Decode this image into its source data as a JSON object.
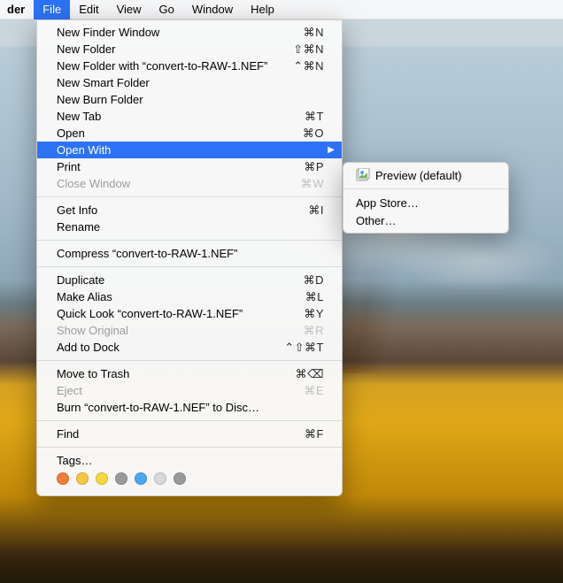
{
  "menubar": {
    "app": "der",
    "items": [
      "File",
      "Edit",
      "View",
      "Go",
      "Window",
      "Help"
    ],
    "activeIndex": 0
  },
  "fileMenu": {
    "groups": [
      [
        {
          "label": "New Finder Window",
          "shortcut": "⌘N"
        },
        {
          "label": "New Folder",
          "shortcut": "⇧⌘N"
        },
        {
          "label": "New Folder with “convert-to-RAW-1.NEF”",
          "shortcut": "⌃⌘N"
        },
        {
          "label": "New Smart Folder",
          "shortcut": ""
        },
        {
          "label": "New Burn Folder",
          "shortcut": ""
        },
        {
          "label": "New Tab",
          "shortcut": "⌘T"
        },
        {
          "label": "Open",
          "shortcut": "⌘O"
        },
        {
          "label": "Open With",
          "shortcut": "",
          "submenu": true,
          "highlight": true
        },
        {
          "label": "Print",
          "shortcut": "⌘P"
        },
        {
          "label": "Close Window",
          "shortcut": "⌘W",
          "disabled": true
        }
      ],
      [
        {
          "label": "Get Info",
          "shortcut": "⌘I"
        },
        {
          "label": "Rename",
          "shortcut": ""
        }
      ],
      [
        {
          "label": "Compress “convert-to-RAW-1.NEF”",
          "shortcut": ""
        }
      ],
      [
        {
          "label": "Duplicate",
          "shortcut": "⌘D"
        },
        {
          "label": "Make Alias",
          "shortcut": "⌘L"
        },
        {
          "label": "Quick Look “convert-to-RAW-1.NEF”",
          "shortcut": "⌘Y"
        },
        {
          "label": "Show Original",
          "shortcut": "⌘R",
          "disabled": true
        },
        {
          "label": "Add to Dock",
          "shortcut": "⌃⇧⌘T"
        }
      ],
      [
        {
          "label": "Move to Trash",
          "shortcut": "⌘⌫"
        },
        {
          "label": "Eject",
          "shortcut": "⌘E",
          "disabled": true
        },
        {
          "label": "Burn “convert-to-RAW-1.NEF” to Disc…",
          "shortcut": ""
        }
      ],
      [
        {
          "label": "Find",
          "shortcut": "⌘F"
        }
      ],
      [
        {
          "label": "Tags…",
          "shortcut": ""
        }
      ]
    ],
    "tagColors": [
      "#f27e3a",
      "#f5c742",
      "#f5d742",
      "#9a9a9a",
      "#4aa7f0",
      "#d8d8d8",
      "#9a9a9a"
    ]
  },
  "openWithSubmenu": {
    "items": [
      {
        "label": "Preview (default)",
        "icon": true
      },
      {
        "separator": true
      },
      {
        "label": "App Store…"
      },
      {
        "label": "Other…"
      }
    ]
  }
}
